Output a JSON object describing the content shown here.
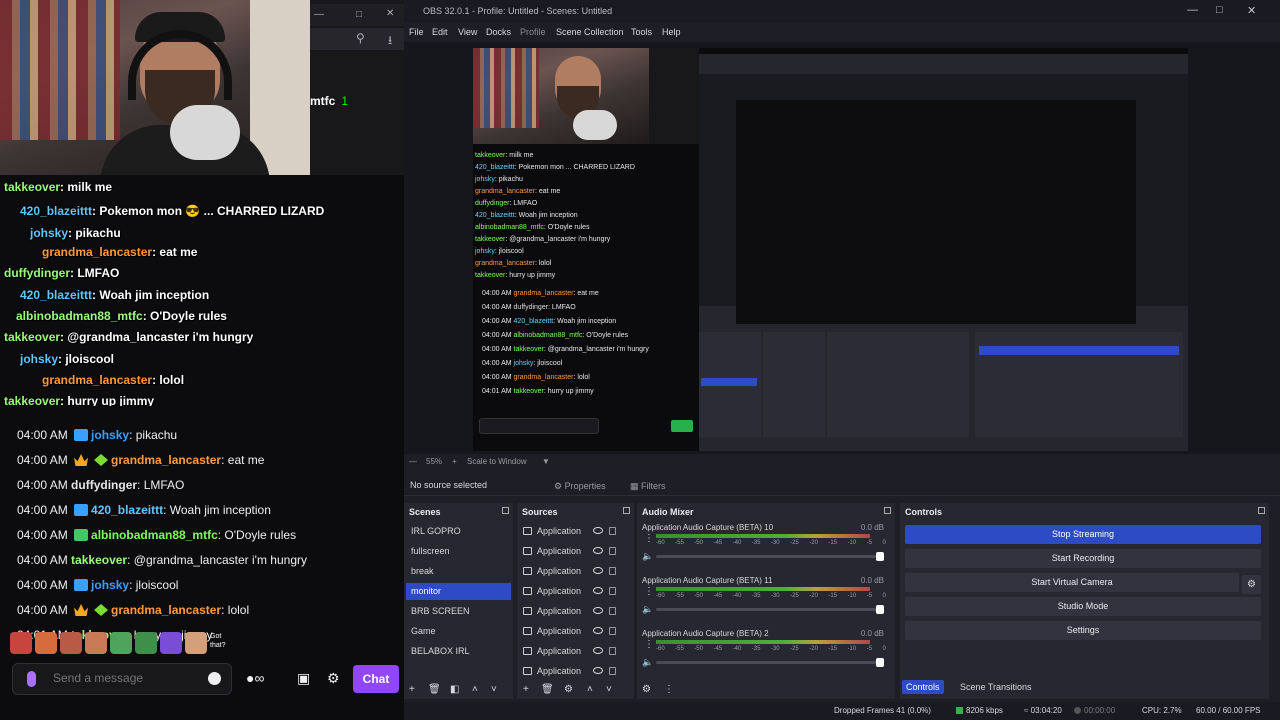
{
  "browser": {
    "search_icon": "search-icon",
    "download_icon": "download-icon",
    "partial_name": "mtfc",
    "partial_badge": "1"
  },
  "ghost_chat": [
    {
      "user": "takkeover",
      "text": ": milk me"
    },
    {
      "user": "420_blazeittt",
      "text": ": Pokemon mon 😎 ... CHARRED LIZARD"
    },
    {
      "user": "johsky",
      "text": ": pikachu"
    },
    {
      "user": "grandma_lancaster",
      "text": ": eat me"
    },
    {
      "user": "duffydinger",
      "text": ": LMFAO"
    },
    {
      "user": "420_blazeittt",
      "text": ": Woah jim inception"
    },
    {
      "user": "albinobadman88_mtfc",
      "text": ": O'Doyle rules"
    },
    {
      "user": "takkeover",
      "text": ": @grandma_lancaster i'm hungry"
    },
    {
      "user": "johsky",
      "text": ": jloiscool"
    },
    {
      "user": "grandma_lancaster",
      "text": ": lolol"
    },
    {
      "user": "takkeover",
      "text": ": hurry up jimmy"
    }
  ],
  "chat": [
    {
      "time": "04:00 AM",
      "badges": [
        "sub"
      ],
      "user": "johsky",
      "user_color": "#39a0ff",
      "text": ": pikachu"
    },
    {
      "time": "04:00 AM",
      "badges": [
        "crown",
        "gem"
      ],
      "user": "grandma_lancaster",
      "user_color": "#ff9b3d",
      "text": ": eat me"
    },
    {
      "time": "04:00 AM",
      "badges": [],
      "user": "duffydinger",
      "user_color": "#e6e6e6",
      "text": ": LMFAO"
    },
    {
      "time": "04:00 AM",
      "badges": [
        "sub"
      ],
      "user": "420_blazeittt",
      "user_color": "#5fc8ff",
      "text": ": Woah jim inception"
    },
    {
      "time": "04:00 AM",
      "badges": [
        "book"
      ],
      "user": "albinobadman88_mtfc",
      "user_color": "#7dff5c",
      "text": ": O'Doyle rules"
    },
    {
      "time": "04:00 AM",
      "badges": [],
      "user": "takkeover",
      "user_color": "#9aff7a",
      "text": ": @grandma_lancaster i'm hungry"
    },
    {
      "time": "04:00 AM",
      "badges": [
        "sub"
      ],
      "user": "johsky",
      "user_color": "#39a0ff",
      "text": ": jloiscool"
    },
    {
      "time": "04:00 AM",
      "badges": [
        "crown",
        "gem"
      ],
      "user": "grandma_lancaster",
      "user_color": "#ff9b3d",
      "text": ": lolol"
    },
    {
      "time": "04:01 AM",
      "badges": [],
      "user": "takkeover",
      "user_color": "#9aff7a",
      "text": ": hurry up jimmy"
    }
  ],
  "chat_input": {
    "placeholder": "Send a message",
    "send_label": "Chat",
    "emote_text": "Got that?"
  },
  "obs": {
    "title": "OBS 32.0.1 - Profile: Untitled - Scenes: Untitled",
    "menu": [
      "File",
      "Edit",
      "View",
      "Docks",
      "Profile",
      "Scene Collection",
      "Tools",
      "Help"
    ],
    "zoom": "55%",
    "scale_mode": "Scale to Window",
    "no_source": "No source selected",
    "properties_label": "Properties",
    "filters_label": "Filters",
    "scenes_title": "Scenes",
    "scenes": [
      "IRL GOPRO",
      "fullscreen",
      "break",
      "monitor",
      "BRB SCREEN",
      "Game",
      "BELABOX IRL"
    ],
    "active_scene": "monitor",
    "sources_title": "Sources",
    "sources": [
      "Application",
      "Application",
      "Application",
      "Application",
      "Application",
      "Application",
      "Application",
      "Application"
    ],
    "mixer_title": "Audio Mixer",
    "channels": [
      {
        "name": "Application Audio Capture (BETA) 10",
        "db": "0.0 dB",
        "level": 0.93
      },
      {
        "name": "Application Audio Capture (BETA) 11",
        "db": "0.0 dB",
        "level": 0.93
      },
      {
        "name": "Application Audio Capture (BETA) 2",
        "db": "0.0 dB",
        "level": 0.93
      }
    ],
    "scale_ticks": [
      "-60",
      "-55",
      "-50",
      "-45",
      "-40",
      "-35",
      "-30",
      "-25",
      "-20",
      "-15",
      "-10",
      "-5",
      "0"
    ],
    "controls_title": "Controls",
    "controls": [
      "Stop Streaming",
      "Start Recording",
      "Start Virtual Camera",
      "Studio Mode",
      "Settings"
    ],
    "dock_tabs": [
      "Controls",
      "Scene Transitions"
    ],
    "status": {
      "dropped": "Dropped Frames 41 (0.0%)",
      "kbps": "8206 kbps",
      "stream_time": "03:04:20",
      "rec_time": "00:00:00",
      "cpu": "CPU: 2.7%",
      "fps": "60.00 / 60.00 FPS"
    }
  }
}
